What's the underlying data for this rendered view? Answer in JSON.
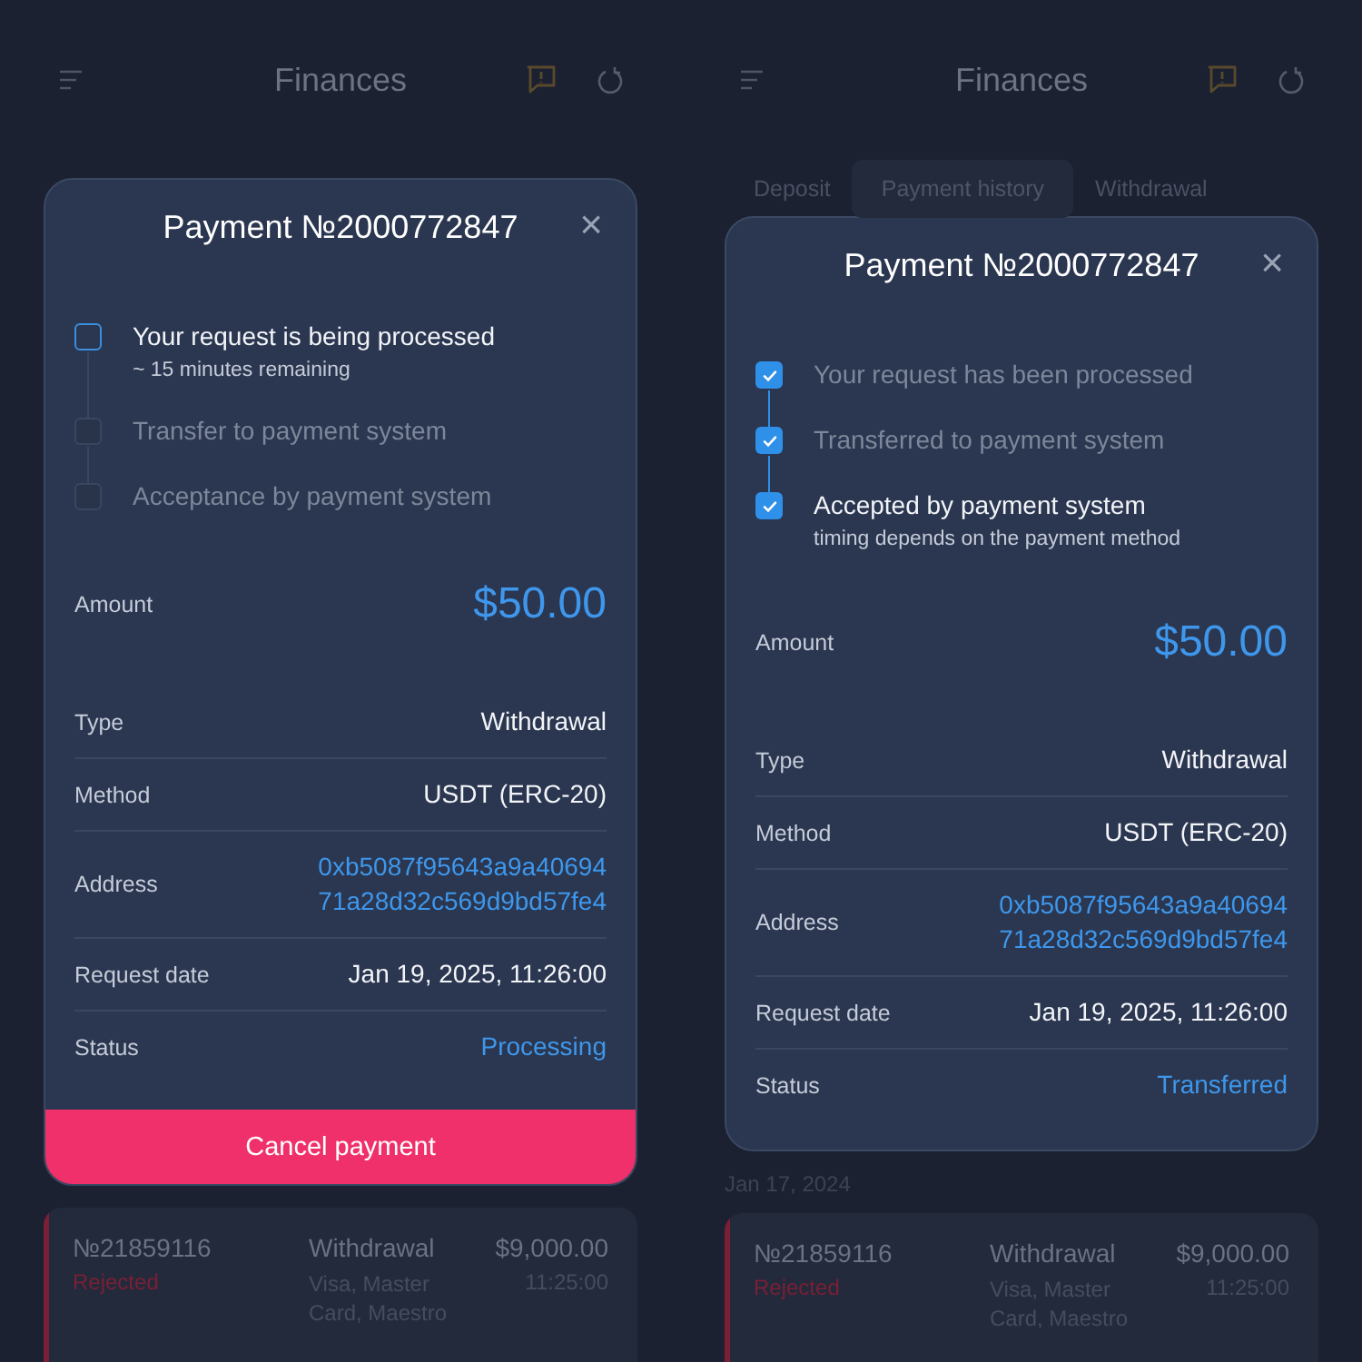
{
  "screens": [
    {
      "header": {
        "title": "Finances"
      },
      "modal": {
        "title": "Payment №2000772847",
        "close": "×",
        "steps": [
          {
            "label": "Your request is being processed",
            "note": "~ 15 minutes remaining",
            "checked": false,
            "active": true
          },
          {
            "label": "Transfer to payment system",
            "checked": false,
            "active": false
          },
          {
            "label": "Acceptance by payment system",
            "checked": false,
            "active": false
          }
        ],
        "amount": {
          "label": "Amount",
          "value": "$50.00"
        },
        "details": [
          {
            "label": "Type",
            "value": "Withdrawal",
            "accent": false
          },
          {
            "label": "Method",
            "value": "USDT (ERC-20)",
            "accent": false
          },
          {
            "label": "Address",
            "value": "0xb5087f95643a9a40694\n71a28d32c569d9bd57fe4",
            "accent": true
          },
          {
            "label": "Request date",
            "value": "Jan 19, 2025, 11:26:00",
            "accent": false
          },
          {
            "label": "Status",
            "value": "Processing",
            "accent": true
          }
        ],
        "action": "Cancel payment"
      },
      "transaction": {
        "number": "№21859116",
        "status": "Rejected",
        "type": "Withdrawal",
        "method": "Visa, Master Card, Maestro",
        "amount": "$9,000.00",
        "time": "11:25:00",
        "color": "#7a1f35"
      }
    },
    {
      "header": {
        "title": "Finances"
      },
      "tabs": [
        {
          "label": "Deposit",
          "selected": false
        },
        {
          "label": "Payment history",
          "selected": true
        },
        {
          "label": "Withdrawal",
          "selected": false
        }
      ],
      "modal": {
        "title": "Payment №2000772847",
        "close": "×",
        "steps": [
          {
            "label": "Your request has been processed",
            "checked": true,
            "active": false
          },
          {
            "label": "Transferred to payment system",
            "checked": true,
            "active": false
          },
          {
            "label": "Accepted by payment system",
            "note": "timing depends on the payment method",
            "checked": true,
            "active": true
          }
        ],
        "amount": {
          "label": "Amount",
          "value": "$50.00"
        },
        "details": [
          {
            "label": "Type",
            "value": "Withdrawal",
            "accent": false
          },
          {
            "label": "Method",
            "value": "USDT (ERC-20)",
            "accent": false
          },
          {
            "label": "Address",
            "value": "0xb5087f95643a9a40694\n71a28d32c569d9bd57fe4",
            "accent": true
          },
          {
            "label": "Request date",
            "value": "Jan 19, 2025, 11:26:00",
            "accent": false
          },
          {
            "label": "Status",
            "value": "Transferred",
            "accent": true
          }
        ]
      },
      "date_label": "Jan 17, 2024",
      "transaction": {
        "number": "№21859116",
        "status": "Rejected",
        "type": "Withdrawal",
        "method": "Visa, Master Card, Maestro",
        "amount": "$9,000.00",
        "time": "11:25:00",
        "color": "#7a1f35"
      }
    }
  ]
}
